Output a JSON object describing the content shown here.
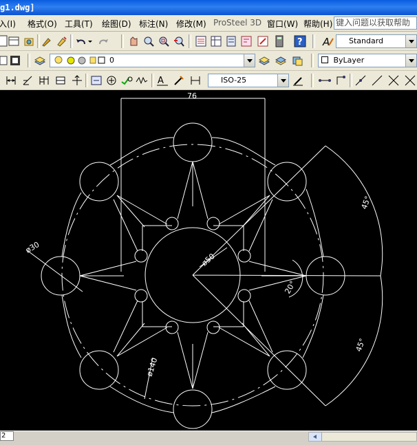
{
  "window": {
    "title": "g1.dwg]"
  },
  "menu": {
    "items": [
      {
        "label": "入(I)"
      },
      {
        "label": "格式(O)"
      },
      {
        "label": "工具(T)"
      },
      {
        "label": "绘图(D)"
      },
      {
        "label": "标注(N)"
      },
      {
        "label": "修改(M)"
      },
      {
        "label": "ProSteel 3D"
      },
      {
        "label": "窗口(W)"
      },
      {
        "label": "帮助(H)"
      }
    ],
    "help_placeholder": "键入问题以获取帮助"
  },
  "toolbar": {
    "text_style": "Standard",
    "layer": "0",
    "linetype": "ByLayer",
    "dim_style": "ISO-25"
  },
  "drawing": {
    "dim_width": "76",
    "dim_hole": "ø30",
    "dim_center": "ø50",
    "dim_small_angle": "20°",
    "dim_angle_upper": "45°",
    "dim_angle_lower": "45°",
    "dim_bolt_circle": "ø140"
  },
  "status": {
    "layout_tab": "2"
  },
  "colors": {
    "canvas": "#000000",
    "geometry": "#ffffff"
  }
}
